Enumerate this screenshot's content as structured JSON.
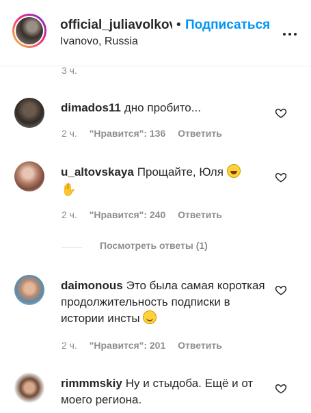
{
  "post_header": {
    "username": "official_juliavolkova",
    "separator": "•",
    "follow_label": "Подписаться",
    "location": "Ivanovo, Russia"
  },
  "previous_comment_time": "3 ч.",
  "comments": [
    {
      "username": "dimados11",
      "text": "дно пробито...",
      "time": "2 ч.",
      "likes": "\"Нравится\": 136",
      "reply_label": "Ответить"
    },
    {
      "username": "u_altovskaya",
      "text": "Прощайте, Юля",
      "emoji": [
        "rolling-on-floor-laughing-emoji",
        "raised-hand-emoji"
      ],
      "time": "2 ч.",
      "likes": "\"Нравится\": 240",
      "reply_label": "Ответить",
      "view_replies_label": "Посмотреть ответы (1)"
    },
    {
      "username": "daimonous",
      "text": "Это была самая короткая продолжительность подписки в истории инсты",
      "emoji": [
        "slightly-smiling-face-emoji"
      ],
      "time": "2 ч.",
      "likes": "\"Нравится\": 201",
      "reply_label": "Ответить"
    },
    {
      "username": "rimmmskiy",
      "text": "Ну и стыдоба. Ещё и от моего региона."
    }
  ],
  "colors": {
    "link_blue": "#0095f6",
    "text": "#262626",
    "secondary_text": "#8e8e8e"
  }
}
